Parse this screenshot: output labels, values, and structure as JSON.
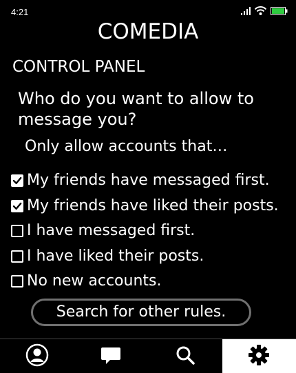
{
  "status_bar": {
    "time": "4:21",
    "icons": [
      "signal-icon",
      "wifi-icon",
      "battery-icon"
    ],
    "battery_color": "#2ecc40"
  },
  "app_title": "COMEDIA",
  "panel_title": "CONTROL PANEL",
  "question": "Who do you want to allow to message you?",
  "subtitle": "Only allow accounts that…",
  "rules": [
    {
      "label": "My friends have messaged first.",
      "checked": true
    },
    {
      "label": "My friends have liked their posts.",
      "checked": true
    },
    {
      "label": "I have messaged first.",
      "checked": false
    },
    {
      "label": "I have liked their posts.",
      "checked": false
    },
    {
      "label": "No new accounts.",
      "checked": false
    }
  ],
  "search_button_label": "Search for other rules.",
  "bottom_nav": [
    {
      "icon": "profile-icon",
      "active": false
    },
    {
      "icon": "chat-icon",
      "active": false
    },
    {
      "icon": "search-icon",
      "active": false
    },
    {
      "icon": "gear-icon",
      "active": true
    }
  ]
}
